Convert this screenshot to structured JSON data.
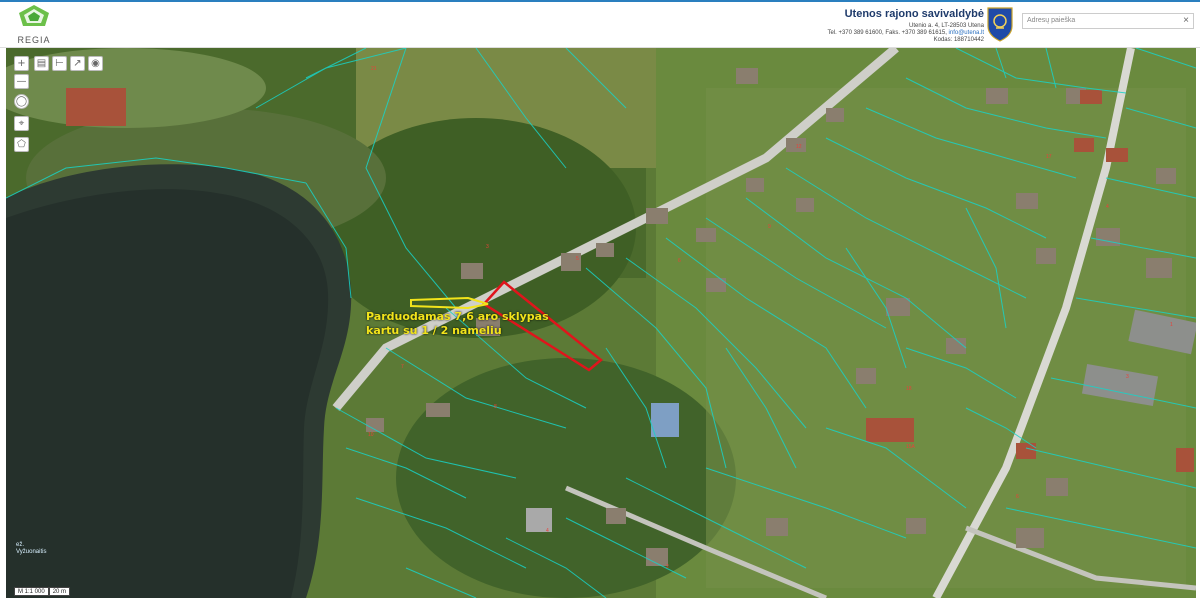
{
  "app": {
    "logo_text": "REGIA"
  },
  "header": {
    "municipality": "Utenos rajono savivaldybė",
    "address": "Utenio a. 4, LT-28503 Utena",
    "phone_line": "Tel. +370 389 61600, Faks. +370 389 61615, ",
    "email": "info@utena.lt",
    "code": "Kodas: 188710442"
  },
  "search": {
    "placeholder": "Adresų paieška"
  },
  "toolbar": {
    "zoom_in": "+",
    "zoom_out": "—"
  },
  "map": {
    "annotation_line1": "Parduodamas 7,6 aro sklypas",
    "annotation_line2": "kartu su 1 / 2 nameliu",
    "lake_label_1": "ež.",
    "lake_label_2": "Vyžuonaitis",
    "scale_ratio": "M 1:1 000",
    "scale_length": "20 m"
  },
  "colors": {
    "accent": "#2a7fbf",
    "plot_outline": "#e0151c",
    "annotation": "#f2e41b",
    "parcel_lines": "#19d3c7"
  }
}
